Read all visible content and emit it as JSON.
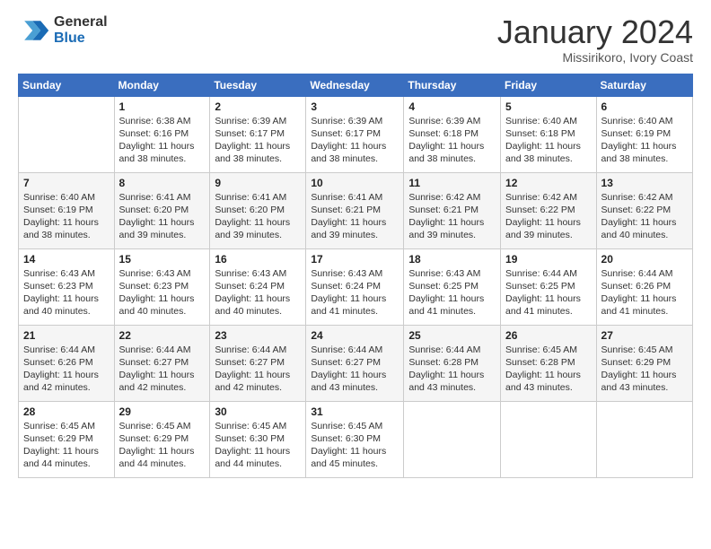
{
  "logo": {
    "line1": "General",
    "line2": "Blue"
  },
  "title": "January 2024",
  "subtitle": "Missirikoro, Ivory Coast",
  "days_header": [
    "Sunday",
    "Monday",
    "Tuesday",
    "Wednesday",
    "Thursday",
    "Friday",
    "Saturday"
  ],
  "weeks": [
    [
      {
        "day": "",
        "info": ""
      },
      {
        "day": "1",
        "info": "Sunrise: 6:38 AM\nSunset: 6:16 PM\nDaylight: 11 hours\nand 38 minutes."
      },
      {
        "day": "2",
        "info": "Sunrise: 6:39 AM\nSunset: 6:17 PM\nDaylight: 11 hours\nand 38 minutes."
      },
      {
        "day": "3",
        "info": "Sunrise: 6:39 AM\nSunset: 6:17 PM\nDaylight: 11 hours\nand 38 minutes."
      },
      {
        "day": "4",
        "info": "Sunrise: 6:39 AM\nSunset: 6:18 PM\nDaylight: 11 hours\nand 38 minutes."
      },
      {
        "day": "5",
        "info": "Sunrise: 6:40 AM\nSunset: 6:18 PM\nDaylight: 11 hours\nand 38 minutes."
      },
      {
        "day": "6",
        "info": "Sunrise: 6:40 AM\nSunset: 6:19 PM\nDaylight: 11 hours\nand 38 minutes."
      }
    ],
    [
      {
        "day": "7",
        "info": "Sunrise: 6:40 AM\nSunset: 6:19 PM\nDaylight: 11 hours\nand 38 minutes."
      },
      {
        "day": "8",
        "info": "Sunrise: 6:41 AM\nSunset: 6:20 PM\nDaylight: 11 hours\nand 39 minutes."
      },
      {
        "day": "9",
        "info": "Sunrise: 6:41 AM\nSunset: 6:20 PM\nDaylight: 11 hours\nand 39 minutes."
      },
      {
        "day": "10",
        "info": "Sunrise: 6:41 AM\nSunset: 6:21 PM\nDaylight: 11 hours\nand 39 minutes."
      },
      {
        "day": "11",
        "info": "Sunrise: 6:42 AM\nSunset: 6:21 PM\nDaylight: 11 hours\nand 39 minutes."
      },
      {
        "day": "12",
        "info": "Sunrise: 6:42 AM\nSunset: 6:22 PM\nDaylight: 11 hours\nand 39 minutes."
      },
      {
        "day": "13",
        "info": "Sunrise: 6:42 AM\nSunset: 6:22 PM\nDaylight: 11 hours\nand 40 minutes."
      }
    ],
    [
      {
        "day": "14",
        "info": "Sunrise: 6:43 AM\nSunset: 6:23 PM\nDaylight: 11 hours\nand 40 minutes."
      },
      {
        "day": "15",
        "info": "Sunrise: 6:43 AM\nSunset: 6:23 PM\nDaylight: 11 hours\nand 40 minutes."
      },
      {
        "day": "16",
        "info": "Sunrise: 6:43 AM\nSunset: 6:24 PM\nDaylight: 11 hours\nand 40 minutes."
      },
      {
        "day": "17",
        "info": "Sunrise: 6:43 AM\nSunset: 6:24 PM\nDaylight: 11 hours\nand 41 minutes."
      },
      {
        "day": "18",
        "info": "Sunrise: 6:43 AM\nSunset: 6:25 PM\nDaylight: 11 hours\nand 41 minutes."
      },
      {
        "day": "19",
        "info": "Sunrise: 6:44 AM\nSunset: 6:25 PM\nDaylight: 11 hours\nand 41 minutes."
      },
      {
        "day": "20",
        "info": "Sunrise: 6:44 AM\nSunset: 6:26 PM\nDaylight: 11 hours\nand 41 minutes."
      }
    ],
    [
      {
        "day": "21",
        "info": "Sunrise: 6:44 AM\nSunset: 6:26 PM\nDaylight: 11 hours\nand 42 minutes."
      },
      {
        "day": "22",
        "info": "Sunrise: 6:44 AM\nSunset: 6:27 PM\nDaylight: 11 hours\nand 42 minutes."
      },
      {
        "day": "23",
        "info": "Sunrise: 6:44 AM\nSunset: 6:27 PM\nDaylight: 11 hours\nand 42 minutes."
      },
      {
        "day": "24",
        "info": "Sunrise: 6:44 AM\nSunset: 6:27 PM\nDaylight: 11 hours\nand 43 minutes."
      },
      {
        "day": "25",
        "info": "Sunrise: 6:44 AM\nSunset: 6:28 PM\nDaylight: 11 hours\nand 43 minutes."
      },
      {
        "day": "26",
        "info": "Sunrise: 6:45 AM\nSunset: 6:28 PM\nDaylight: 11 hours\nand 43 minutes."
      },
      {
        "day": "27",
        "info": "Sunrise: 6:45 AM\nSunset: 6:29 PM\nDaylight: 11 hours\nand 43 minutes."
      }
    ],
    [
      {
        "day": "28",
        "info": "Sunrise: 6:45 AM\nSunset: 6:29 PM\nDaylight: 11 hours\nand 44 minutes."
      },
      {
        "day": "29",
        "info": "Sunrise: 6:45 AM\nSunset: 6:29 PM\nDaylight: 11 hours\nand 44 minutes."
      },
      {
        "day": "30",
        "info": "Sunrise: 6:45 AM\nSunset: 6:30 PM\nDaylight: 11 hours\nand 44 minutes."
      },
      {
        "day": "31",
        "info": "Sunrise: 6:45 AM\nSunset: 6:30 PM\nDaylight: 11 hours\nand 45 minutes."
      },
      {
        "day": "",
        "info": ""
      },
      {
        "day": "",
        "info": ""
      },
      {
        "day": "",
        "info": ""
      }
    ]
  ]
}
